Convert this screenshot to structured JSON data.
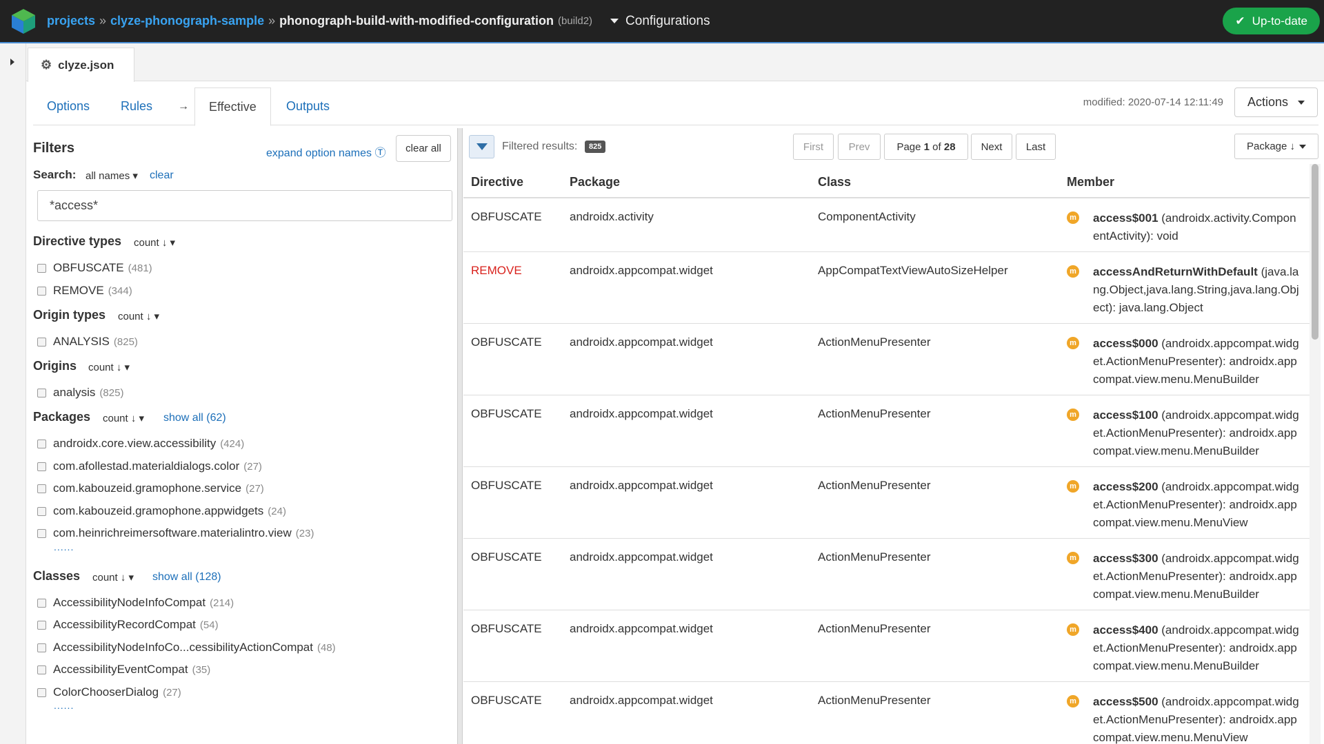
{
  "breadcrumb": {
    "projects": "projects",
    "project": "clyze-phonograph-sample",
    "build": "phonograph-build-with-modified-configuration",
    "build_id": "(build2)",
    "separator": "»"
  },
  "config_menu": "Configurations",
  "status": "Up-to-date",
  "file_tab": "clyze.json",
  "tabs": [
    "Options",
    "Rules",
    "Effective",
    "Outputs"
  ],
  "tab_arrow": "→",
  "modified": "modified: 2020-07-14 12:11:49",
  "actions": "Actions",
  "filters": {
    "title": "Filters",
    "expand": "expand option names",
    "clear_all": "clear all",
    "search_label": "Search:",
    "all_names": "all names ▾",
    "search_clear": "clear",
    "search_value": "*access*",
    "sort_label": "count ↓ ▾",
    "dots": "......",
    "groups": [
      {
        "title": "Directive types",
        "items": [
          {
            "label": "OBFUSCATE",
            "count": "(481)"
          },
          {
            "label": "REMOVE",
            "count": "(344)"
          }
        ]
      },
      {
        "title": "Origin types",
        "items": [
          {
            "label": "ANALYSIS",
            "count": "(825)"
          }
        ]
      },
      {
        "title": "Origins",
        "items": [
          {
            "label": "analysis",
            "count": "(825)"
          }
        ]
      },
      {
        "title": "Packages",
        "show_all": "show all (62)",
        "items": [
          {
            "label": "androidx.core.view.accessibility",
            "count": "(424)"
          },
          {
            "label": "com.afollestad.materialdialogs.color",
            "count": "(27)"
          },
          {
            "label": "com.kabouzeid.gramophone.service",
            "count": "(27)"
          },
          {
            "label": "com.kabouzeid.gramophone.appwidgets",
            "count": "(24)"
          },
          {
            "label": "com.heinrichreimersoftware.materialintro.view",
            "count": "(23)"
          }
        ]
      },
      {
        "title": "Classes",
        "show_all": "show all (128)",
        "items": [
          {
            "label": "AccessibilityNodeInfoCompat",
            "count": "(214)"
          },
          {
            "label": "AccessibilityRecordCompat",
            "count": "(54)"
          },
          {
            "label": "AccessibilityNodeInfoCo...cessibilityActionCompat",
            "count": "(48)"
          },
          {
            "label": "AccessibilityEventCompat",
            "count": "(35)"
          },
          {
            "label": "ColorChooserDialog",
            "count": "(27)"
          }
        ]
      }
    ]
  },
  "results": {
    "filtered_label": "Filtered results:",
    "count": "825",
    "pager": {
      "first": "First",
      "prev": "Prev",
      "page_prefix": "Page",
      "page": "1",
      "page_of": "of",
      "pages": "28",
      "next": "Next",
      "last": "Last"
    },
    "sort": "Package ↓",
    "columns": [
      "Directive",
      "Package",
      "Class",
      "Member"
    ],
    "member_icon": "m",
    "rows": [
      {
        "directive": "OBFUSCATE",
        "package": "androidx.activity",
        "class": "ComponentActivity",
        "member_name": "access$001",
        "member_sig": " (androidx.activity.ComponentActivity): void"
      },
      {
        "directive": "REMOVE",
        "package": "androidx.appcompat.widget",
        "class": "AppCompatTextViewAutoSizeHelper",
        "member_name": "accessAndReturnWithDefault",
        "member_sig": " (java.lang.Object,java.lang.String,java.lang.Object): java.lang.Object"
      },
      {
        "directive": "OBFUSCATE",
        "package": "androidx.appcompat.widget",
        "class": "ActionMenuPresenter",
        "member_name": "access$000",
        "member_sig": " (androidx.appcompat.widget.ActionMenuPresenter): androidx.appcompat.view.menu.MenuBuilder"
      },
      {
        "directive": "OBFUSCATE",
        "package": "androidx.appcompat.widget",
        "class": "ActionMenuPresenter",
        "member_name": "access$100",
        "member_sig": " (androidx.appcompat.widget.ActionMenuPresenter): androidx.appcompat.view.menu.MenuBuilder"
      },
      {
        "directive": "OBFUSCATE",
        "package": "androidx.appcompat.widget",
        "class": "ActionMenuPresenter",
        "member_name": "access$200",
        "member_sig": " (androidx.appcompat.widget.ActionMenuPresenter): androidx.appcompat.view.menu.MenuView"
      },
      {
        "directive": "OBFUSCATE",
        "package": "androidx.appcompat.widget",
        "class": "ActionMenuPresenter",
        "member_name": "access$300",
        "member_sig": " (androidx.appcompat.widget.ActionMenuPresenter): androidx.appcompat.view.menu.MenuBuilder"
      },
      {
        "directive": "OBFUSCATE",
        "package": "androidx.appcompat.widget",
        "class": "ActionMenuPresenter",
        "member_name": "access$400",
        "member_sig": " (androidx.appcompat.widget.ActionMenuPresenter): androidx.appcompat.view.menu.MenuBuilder"
      },
      {
        "directive": "OBFUSCATE",
        "package": "androidx.appcompat.widget",
        "class": "ActionMenuPresenter",
        "member_name": "access$500",
        "member_sig": " (androidx.appcompat.widget.ActionMenuPresenter): androidx.appcompat.view.menu.MenuView"
      }
    ]
  },
  "colors": {
    "accent": "#1c6fb9",
    "success": "#1aa34a",
    "remove": "#d9221d",
    "member_icon": "#f0a628",
    "topbar": "#222222"
  }
}
